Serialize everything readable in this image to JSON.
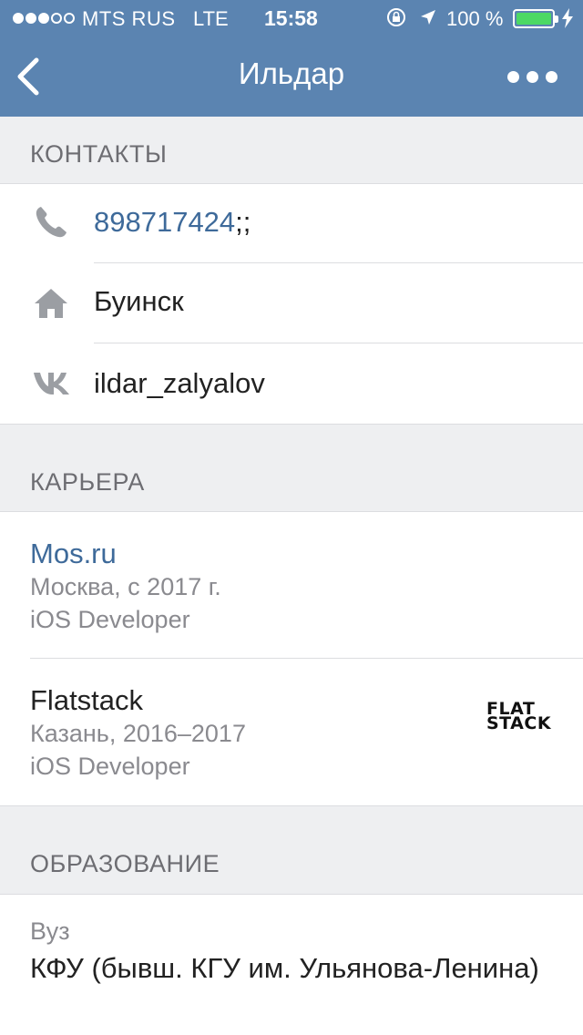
{
  "status_bar": {
    "carrier": "MTS RUS",
    "network": "LTE",
    "time": "15:58",
    "battery_percent": "100 %",
    "signal_bars_filled": 3,
    "signal_bars_total": 5
  },
  "nav": {
    "title": "Ильдар"
  },
  "contacts": {
    "header": "КОНТАКТЫ",
    "phone": "898717424",
    "phone_suffix": ";;",
    "city": "Буинск",
    "vk": "ildar_zalyalov"
  },
  "career": {
    "header": "КАРЬЕРА",
    "items": [
      {
        "company": "Mos.ru",
        "place": "Москва, с 2017 г.",
        "position": "iOS Developer"
      },
      {
        "company": "Flatstack",
        "place": "Казань, 2016–2017",
        "position": "iOS Developer",
        "logo_line1": "FLAT",
        "logo_line2": "STACK"
      }
    ]
  },
  "education": {
    "header": "ОБРАЗОВАНИЕ",
    "type_label": "Вуз",
    "university": "КФУ (бывш. КГУ им. Ульянова-Ленина)"
  },
  "colors": {
    "nav_bg": "#5b84b1",
    "link": "#3e6a9a",
    "section_bg": "#eeeff1",
    "battery": "#4cd964"
  }
}
